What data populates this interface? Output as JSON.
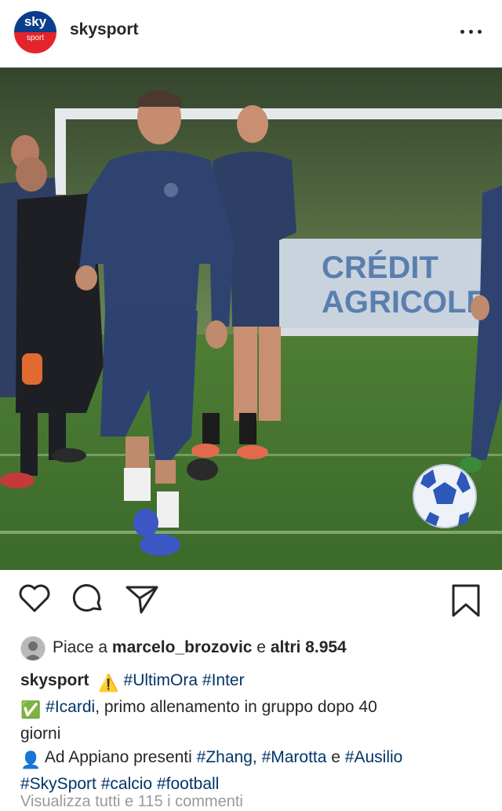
{
  "header": {
    "username": "skysport",
    "avatar": {
      "brand_top": "sky",
      "brand_bottom": "sport",
      "color_top": "#0a3e8c",
      "color_bottom": "#e4232b"
    },
    "more_icon": "more-horizontal-icon"
  },
  "photo": {
    "banner_line1": "CRÉDIT",
    "banner_line2": "AGRICOLE"
  },
  "actions": {
    "like_icon": "heart-icon",
    "comment_icon": "comment-icon",
    "share_icon": "share-icon",
    "save_icon": "bookmark-icon"
  },
  "likes": {
    "prefix": "Piace a ",
    "user": "marcelo_brozovic",
    "middle": " e ",
    "others": "altri 8.954"
  },
  "caption": {
    "author": "skysport",
    "warning_emoji": "⚠️",
    "hashtags_line1": [
      "#UltimOra",
      "#Inter"
    ],
    "check_emoji": "✅",
    "line2_tag": "#Icardi",
    "line2_text": ", primo allenamento in gruppo dopo 40",
    "line3_text": "giorni",
    "person_emoji": "👤",
    "line4_text": " Ad Appiano presenti ",
    "line4_tag1": "#Zhang",
    "line4_sep": ", ",
    "line4_tag2": "#Marotta",
    "line4_and": " e ",
    "line4_tag3": "#Ausilio",
    "line5_tags": [
      "#SkySport",
      "#calcio",
      "#football"
    ]
  },
  "comments_link": "Visualizza tutti e 115 i commenti"
}
